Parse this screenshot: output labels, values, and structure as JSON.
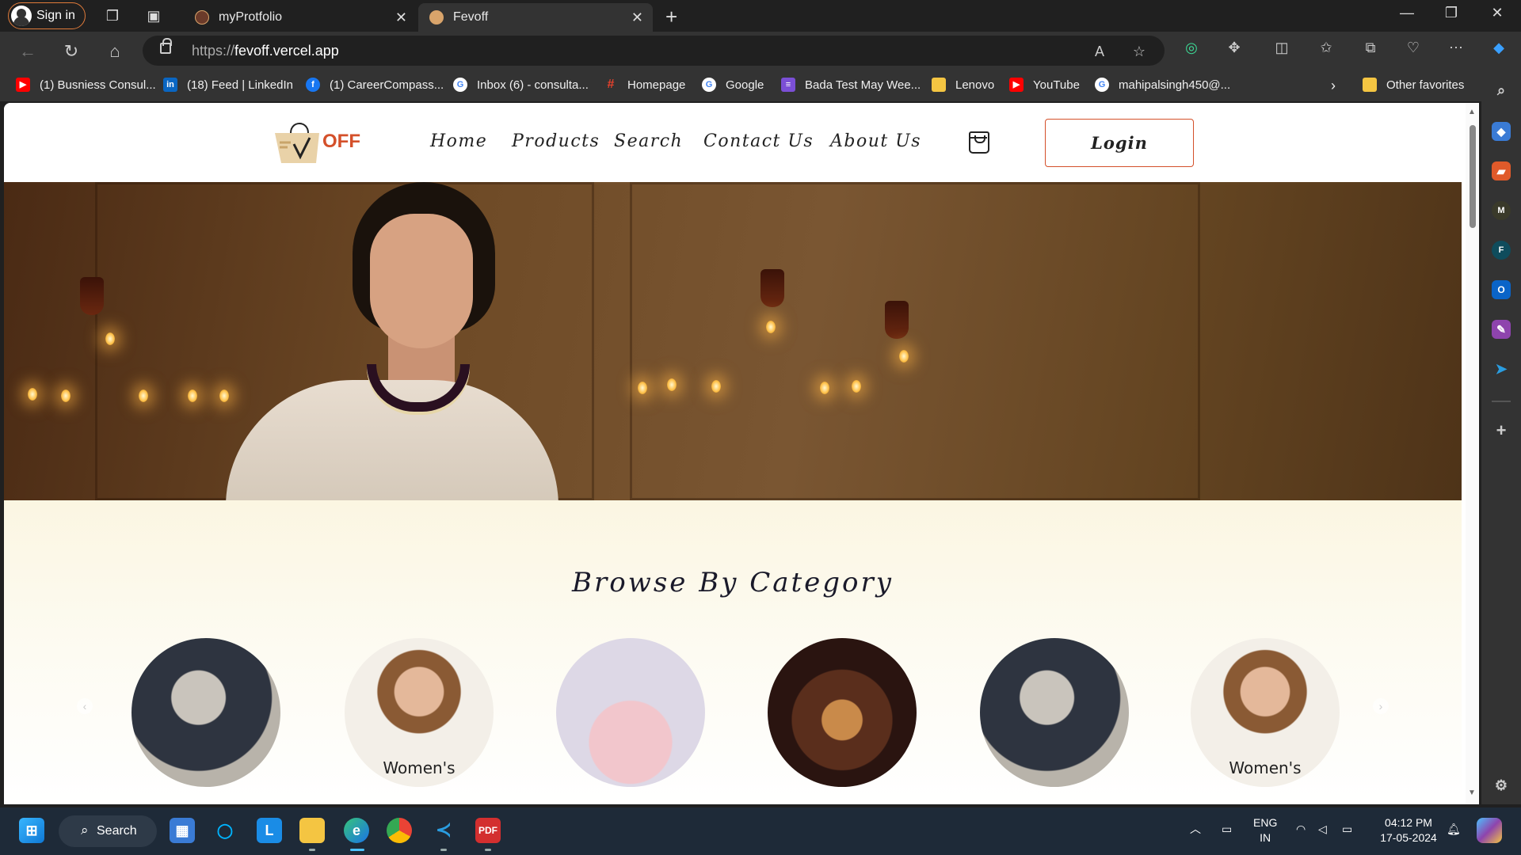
{
  "browser": {
    "signin_label": "Sign in",
    "tabs": [
      {
        "title": "myProtfolio",
        "favicon_color": "#6b3b2a"
      },
      {
        "title": "Fevoff",
        "favicon_color": "#d9a46b"
      }
    ],
    "address": {
      "scheme": "https://",
      "host": "fevoff.vercel.app"
    },
    "favorites": [
      {
        "label": "(1) Busniess Consul...",
        "icon": "youtube-icon",
        "color": "#ff0000"
      },
      {
        "label": "(18) Feed | LinkedIn",
        "icon": "linkedin-icon",
        "color": "#0a66c2"
      },
      {
        "label": "(1) CareerCompass...",
        "icon": "facebook-icon",
        "color": "#1877f2"
      },
      {
        "label": "Inbox (6) - consulta...",
        "icon": "google-icon",
        "color": "#ffffff"
      },
      {
        "label": "Homepage",
        "icon": "homepage-icon",
        "color": "#e8412c"
      },
      {
        "label": "Google",
        "icon": "google-icon",
        "color": "#ffffff"
      },
      {
        "label": "Bada Test May Wee...",
        "icon": "form-icon",
        "color": "#7b4fd6"
      },
      {
        "label": "Lenovo",
        "icon": "folder-icon",
        "color": "#f4c542"
      },
      {
        "label": "YouTube",
        "icon": "youtube-icon",
        "color": "#ff0000"
      },
      {
        "label": "mahipalsingh450@...",
        "icon": "google-icon",
        "color": "#ffffff"
      }
    ],
    "other_favorites": "Other favorites"
  },
  "site": {
    "nav": [
      "Home",
      "Products",
      "Search",
      "Contact Us",
      "About Us"
    ],
    "login_label": "Login",
    "logo_text": "OFF",
    "category_title": "Browse By Category",
    "categories": [
      {
        "label": "",
        "kind": "men"
      },
      {
        "label": "Women's",
        "kind": "women"
      },
      {
        "label": "",
        "kind": "kids"
      },
      {
        "label": "",
        "kind": "party"
      },
      {
        "label": "",
        "kind": "men"
      },
      {
        "label": "Women's",
        "kind": "women"
      }
    ]
  },
  "taskbar": {
    "search_label": "Search",
    "lang_line1": "ENG",
    "lang_line2": "IN",
    "time": "04:12 PM",
    "date": "17-05-2024"
  },
  "colors": {
    "accent_border": "#d4502a",
    "edge_blue": "#1a73e8"
  }
}
